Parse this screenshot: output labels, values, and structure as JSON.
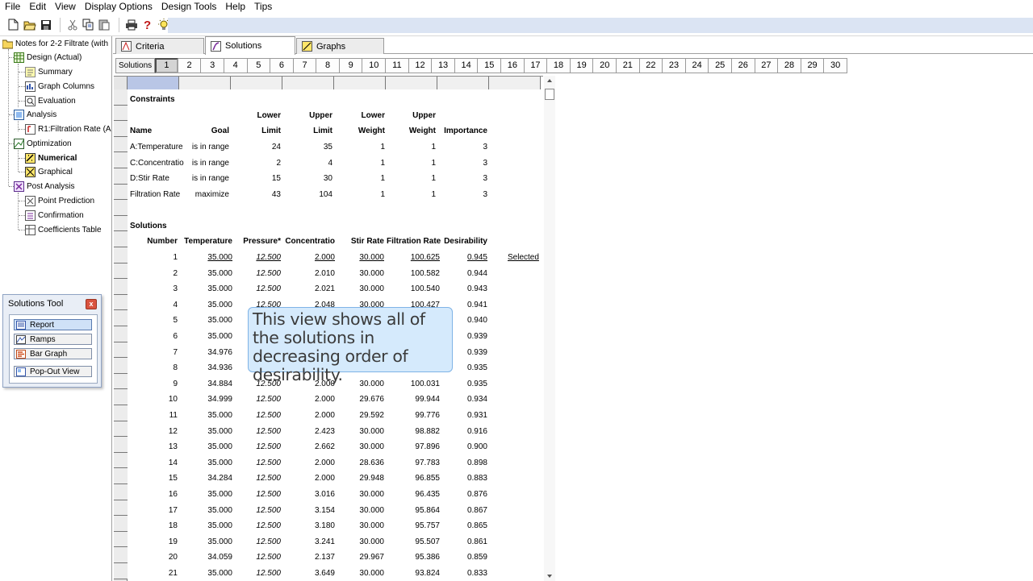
{
  "menu": [
    "File",
    "Edit",
    "View",
    "Display Options",
    "Design Tools",
    "Help",
    "Tips"
  ],
  "toolbar": {
    "icons": [
      "new-document-icon",
      "open-folder-icon",
      "save-icon",
      "cut-icon",
      "copy-icon",
      "paste-icon",
      "print-icon",
      "help-icon",
      "tip-bulb-icon"
    ]
  },
  "tree": {
    "root": "Notes for 2-2 Filtrate (with",
    "design": "Design (Actual)",
    "summary": "Summary",
    "graph_columns": "Graph Columns",
    "evaluation": "Evaluation",
    "analysis": "Analysis",
    "r1": "R1:Filtration Rate (A",
    "optimization": "Optimization",
    "numerical": "Numerical",
    "graphical": "Graphical",
    "post_analysis": "Post Analysis",
    "point_prediction": "Point Prediction",
    "confirmation": "Confirmation",
    "coefficients_table": "Coefficients Table"
  },
  "solutions_tool": {
    "title": "Solutions Tool",
    "report": "Report",
    "ramps": "Ramps",
    "bar_graph": "Bar Graph",
    "pop_out": "Pop-Out View"
  },
  "tabs": {
    "criteria": "Criteria",
    "solutions": "Solutions",
    "graphs": "Graphs"
  },
  "solbar": {
    "label": "Solutions",
    "numbers": [
      "1",
      "2",
      "3",
      "4",
      "5",
      "6",
      "7",
      "8",
      "9",
      "10",
      "11",
      "12",
      "13",
      "14",
      "15",
      "16",
      "17",
      "18",
      "19",
      "20",
      "21",
      "22",
      "23",
      "24",
      "25",
      "26",
      "27",
      "28",
      "29",
      "30"
    ],
    "selected": "1"
  },
  "constraints": {
    "title": "Constraints",
    "header1": [
      "",
      "",
      "Lower",
      "Upper",
      "Lower",
      "Upper",
      ""
    ],
    "header2": [
      "Name",
      "Goal",
      "Limit",
      "Limit",
      "Weight",
      "Weight",
      "Importance"
    ],
    "rows": [
      [
        "A:Temperature",
        "is in range",
        "24",
        "35",
        "1",
        "1",
        "3"
      ],
      [
        "C:Concentratio",
        "is in range",
        "2",
        "4",
        "1",
        "1",
        "3"
      ],
      [
        "D:Stir Rate",
        "is in range",
        "15",
        "30",
        "1",
        "1",
        "3"
      ],
      [
        "Filtration Rate",
        "maximize",
        "43",
        "104",
        "1",
        "1",
        "3"
      ]
    ]
  },
  "solutions": {
    "title": "Solutions",
    "headers": [
      "Number",
      "Temperature",
      "Pressure*",
      "Concentratio",
      "Stir Rate",
      "Filtration Rate",
      "Desirability"
    ],
    "selected_label": "Selected",
    "rows": [
      [
        "1",
        "35.000",
        "12.500",
        "2.000",
        "30.000",
        "100.625",
        "0.945"
      ],
      [
        "2",
        "35.000",
        "12.500",
        "2.010",
        "30.000",
        "100.582",
        "0.944"
      ],
      [
        "3",
        "35.000",
        "12.500",
        "2.021",
        "30.000",
        "100.540",
        "0.943"
      ],
      [
        "4",
        "35.000",
        "12.500",
        "2.048",
        "30.000",
        "100.427",
        "0.941"
      ],
      [
        "5",
        "35.000",
        "",
        "",
        "",
        "",
        "0.940"
      ],
      [
        "6",
        "35.000",
        "",
        "",
        "",
        "",
        "0.939"
      ],
      [
        "7",
        "34.976",
        "",
        "",
        "",
        "",
        "0.939"
      ],
      [
        "8",
        "34.936",
        "",
        "",
        "",
        "",
        "0.935"
      ],
      [
        "9",
        "34.884",
        "12.500",
        "2.000",
        "30.000",
        "100.031",
        "0.935"
      ],
      [
        "10",
        "34.999",
        "12.500",
        "2.000",
        "29.676",
        "99.944",
        "0.934"
      ],
      [
        "11",
        "35.000",
        "12.500",
        "2.000",
        "29.592",
        "99.776",
        "0.931"
      ],
      [
        "12",
        "35.000",
        "12.500",
        "2.423",
        "30.000",
        "98.882",
        "0.916"
      ],
      [
        "13",
        "35.000",
        "12.500",
        "2.662",
        "30.000",
        "97.896",
        "0.900"
      ],
      [
        "14",
        "35.000",
        "12.500",
        "2.000",
        "28.636",
        "97.783",
        "0.898"
      ],
      [
        "15",
        "34.284",
        "12.500",
        "2.000",
        "29.948",
        "96.855",
        "0.883"
      ],
      [
        "16",
        "35.000",
        "12.500",
        "3.016",
        "30.000",
        "96.435",
        "0.876"
      ],
      [
        "17",
        "35.000",
        "12.500",
        "3.154",
        "30.000",
        "95.864",
        "0.867"
      ],
      [
        "18",
        "35.000",
        "12.500",
        "3.180",
        "30.000",
        "95.757",
        "0.865"
      ],
      [
        "19",
        "35.000",
        "12.500",
        "3.241",
        "30.000",
        "95.507",
        "0.861"
      ],
      [
        "20",
        "34.059",
        "12.500",
        "2.137",
        "29.967",
        "95.386",
        "0.859"
      ],
      [
        "21",
        "35.000",
        "12.500",
        "3.649",
        "30.000",
        "93.824",
        "0.833"
      ]
    ]
  },
  "callout": "This view shows all of the solutions in decreasing order of desirability.",
  "colors": {
    "accent_blue": "#dbe4f3",
    "selected_col": "#b9c6e6",
    "callout_bg": "#d2e8fc"
  }
}
